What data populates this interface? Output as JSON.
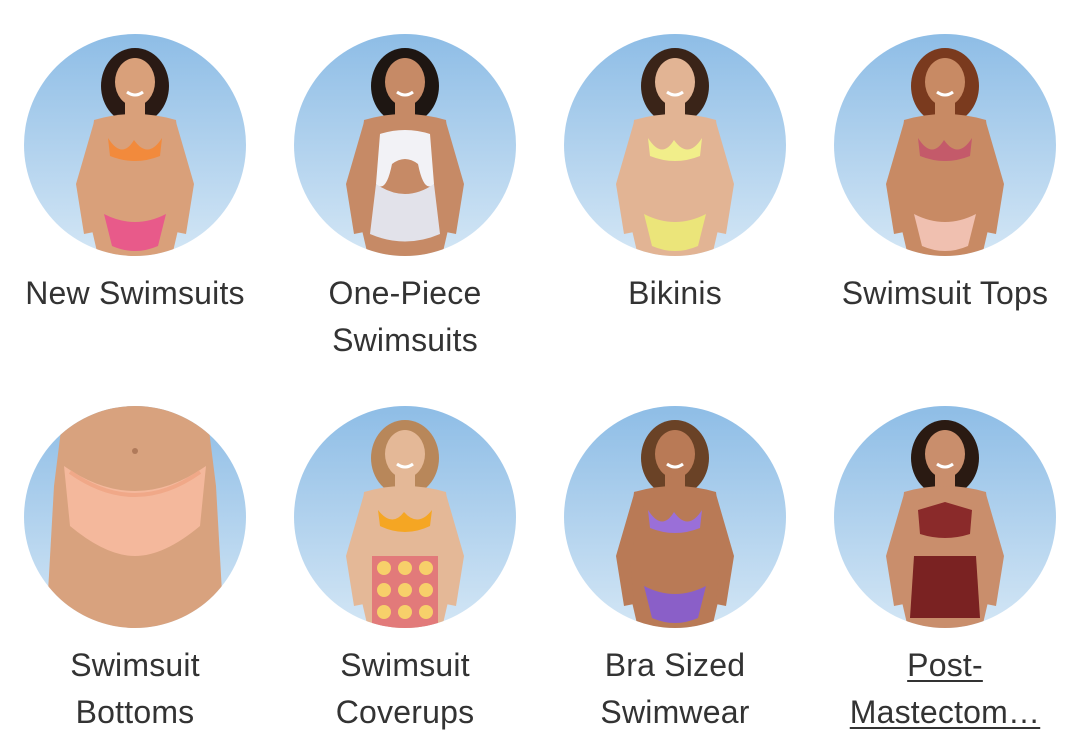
{
  "categories": [
    {
      "label_lines": [
        "New Swimsuits"
      ],
      "image": "model-patterned-bandeau-bikini",
      "colors": {
        "suit": "#f28a3c",
        "suit2": "#e85a8a",
        "hair": "#2a1a14",
        "skin": "#d9a07a"
      }
    },
    {
      "label_lines": [
        "One-Piece",
        "Swimsuits"
      ],
      "image": "model-white-cutout-one-piece",
      "colors": {
        "suit": "#f2f2f6",
        "suit2": "#e2e2ea",
        "hair": "#1e1612",
        "skin": "#c68a66"
      }
    },
    {
      "label_lines": [
        "Bikinis"
      ],
      "image": "model-yellow-bikini",
      "colors": {
        "suit": "#f1ee8a",
        "suit2": "#ebe57a",
        "hair": "#3a2418",
        "skin": "#e2b494"
      }
    },
    {
      "label_lines": [
        "Swimsuit Tops"
      ],
      "image": "model-floral-triangle-top",
      "colors": {
        "suit": "#c45a6a",
        "suit2": "#f0c0b0",
        "hair": "#7a3a1e",
        "skin": "#c88a64"
      }
    },
    {
      "label_lines": [
        "Swimsuit",
        "Bottoms"
      ],
      "image": "model-peach-bikini-bottom",
      "colors": {
        "suit": "#f4b89c",
        "suit2": "#f0a888",
        "hair": "#000000",
        "skin": "#d8a27e"
      }
    },
    {
      "label_lines": [
        "Swimsuit",
        "Coverups"
      ],
      "image": "model-crochet-coverup-skirt",
      "colors": {
        "suit": "#f5a623",
        "suit2": "#e27a7a",
        "hair": "#b8875a",
        "skin": "#e4b897"
      }
    },
    {
      "label_lines": [
        "Bra Sized",
        "Swimwear"
      ],
      "image": "model-purple-bra-sized-bikini",
      "colors": {
        "suit": "#9a6fd8",
        "suit2": "#8a5fc8",
        "hair": "#6a4226",
        "skin": "#b97a56"
      }
    },
    {
      "label_lines": [
        "Post-",
        "Mastectom…"
      ],
      "image": "model-burgundy-high-waist-bikini",
      "link": true,
      "colors": {
        "suit": "#8a2a2a",
        "suit2": "#7a2222",
        "hair": "#2a1a12",
        "skin": "#c98e6c"
      }
    }
  ],
  "theme": {
    "sky_top": "#8ebde6",
    "sky_bottom": "#d3e6f5",
    "text": "#333333"
  }
}
